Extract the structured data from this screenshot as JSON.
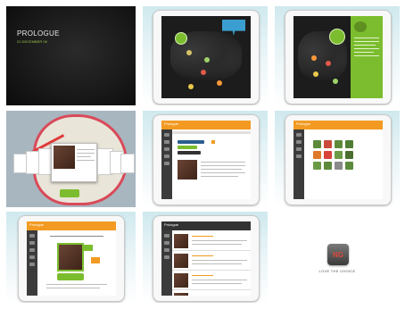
{
  "title_card": {
    "title": "PROLOGUE",
    "subtitle": "21 DECEMBER 06"
  },
  "map_screen": {
    "bubble_text": "",
    "pin_colors": [
      "#d6c16a",
      "#9fd26a",
      "#e05a4a",
      "#ff9a3a",
      "#e9c84a"
    ]
  },
  "app_header": {
    "brand": "Prologue"
  },
  "logo_tile": {
    "caption": "LOVE THE CHOICE",
    "logo_letters": "NG"
  },
  "colors": {
    "accent_orange": "#f29a22",
    "accent_green": "#7bbd2e",
    "sidebar_dark": "#3b3b3b",
    "background_teal": "#cfe9ee",
    "map_dark": "#1c1c1c"
  }
}
